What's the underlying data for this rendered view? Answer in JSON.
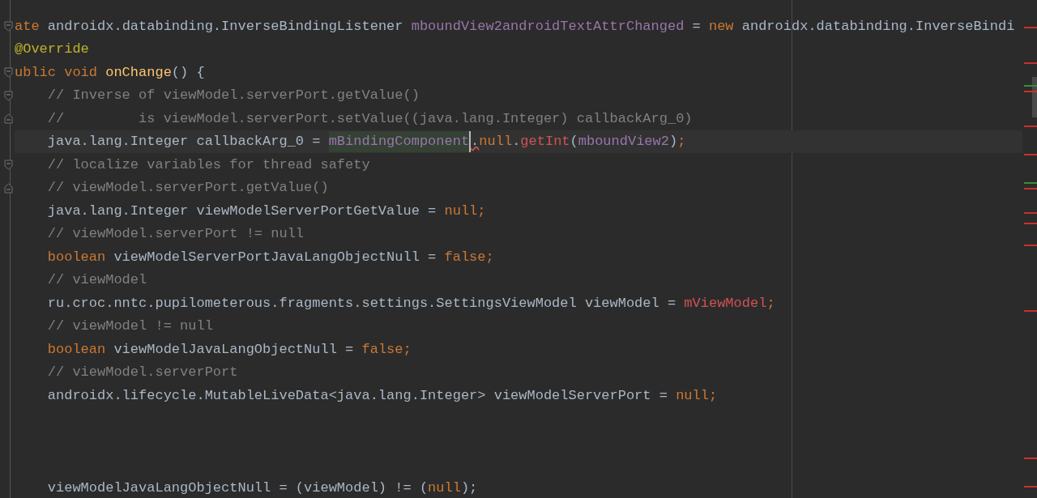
{
  "editor": {
    "lines": [
      {
        "current": false,
        "fold_start": true,
        "fold_end": false,
        "tokens": [
          {
            "kind": "keyword",
            "text": "ate"
          },
          {
            "kind": "plain",
            "text": " androidx.databinding.InverseBindingListener "
          },
          {
            "kind": "field",
            "text": "mboundView2androidTextAttrChanged"
          },
          {
            "kind": "plain",
            "text": " = "
          },
          {
            "kind": "keyword",
            "text": "new"
          },
          {
            "kind": "plain",
            "text": " androidx.databinding.InverseBindi"
          }
        ]
      },
      {
        "current": false,
        "fold_start": false,
        "fold_end": false,
        "tokens": [
          {
            "kind": "annotation",
            "text": "@Override"
          }
        ]
      },
      {
        "current": false,
        "fold_start": true,
        "fold_end": false,
        "tokens": [
          {
            "kind": "keyword",
            "text": "ublic void "
          },
          {
            "kind": "method",
            "text": "onChange"
          },
          {
            "kind": "plain",
            "text": "() {"
          }
        ]
      },
      {
        "current": false,
        "fold_start": true,
        "fold_end": false,
        "tokens": [
          {
            "kind": "comment",
            "text": "    // Inverse of viewModel.serverPort.getValue()"
          }
        ]
      },
      {
        "current": false,
        "fold_start": false,
        "fold_end": true,
        "tokens": [
          {
            "kind": "comment",
            "text": "    //         is viewModel.serverPort.setValue((java.lang.Integer) callbackArg_0)"
          }
        ]
      },
      {
        "current": true,
        "fold_start": false,
        "fold_end": false,
        "tokens": [
          {
            "kind": "plain",
            "text": "    java.lang.Integer callbackArg_0 = "
          },
          {
            "kind": "field_match",
            "text": "mBindingComponent"
          },
          {
            "kind": "caret_dot",
            "text": "."
          },
          {
            "kind": "keyword",
            "text": "null"
          },
          {
            "kind": "plain",
            "text": "."
          },
          {
            "kind": "error",
            "text": "getInt"
          },
          {
            "kind": "plain",
            "text": "("
          },
          {
            "kind": "field",
            "text": "mboundView2"
          },
          {
            "kind": "plain",
            "text": ")"
          },
          {
            "kind": "keyword",
            "text": ";"
          }
        ]
      },
      {
        "current": false,
        "fold_start": true,
        "fold_end": false,
        "tokens": [
          {
            "kind": "comment",
            "text": "    // localize variables for thread safety"
          }
        ]
      },
      {
        "current": false,
        "fold_start": false,
        "fold_end": true,
        "tokens": [
          {
            "kind": "comment",
            "text": "    // viewModel.serverPort.getValue()"
          }
        ]
      },
      {
        "current": false,
        "tokens": [
          {
            "kind": "plain",
            "text": "    java.lang.Integer viewModelServerPortGetValue = "
          },
          {
            "kind": "keyword",
            "text": "null;"
          }
        ]
      },
      {
        "current": false,
        "tokens": [
          {
            "kind": "comment",
            "text": "    // viewModel.serverPort != null"
          }
        ]
      },
      {
        "current": false,
        "tokens": [
          {
            "kind": "keyword",
            "text": "    boolean"
          },
          {
            "kind": "plain",
            "text": " viewModelServerPortJavaLangObjectNull = "
          },
          {
            "kind": "keyword",
            "text": "false;"
          }
        ]
      },
      {
        "current": false,
        "tokens": [
          {
            "kind": "comment",
            "text": "    // viewModel"
          }
        ]
      },
      {
        "current": false,
        "tokens": [
          {
            "kind": "plain",
            "text": "    ru.croc.nntc.pupilometerous.fragments.settings.SettingsViewModel viewModel = "
          },
          {
            "kind": "error",
            "text": "mViewModel"
          },
          {
            "kind": "keyword",
            "text": ";"
          }
        ]
      },
      {
        "current": false,
        "tokens": [
          {
            "kind": "comment",
            "text": "    // viewModel != null"
          }
        ]
      },
      {
        "current": false,
        "tokens": [
          {
            "kind": "keyword",
            "text": "    boolean"
          },
          {
            "kind": "plain",
            "text": " viewModelJavaLangObjectNull = "
          },
          {
            "kind": "keyword",
            "text": "false;"
          }
        ]
      },
      {
        "current": false,
        "tokens": [
          {
            "kind": "comment",
            "text": "    // viewModel.serverPort"
          }
        ]
      },
      {
        "current": false,
        "tokens": [
          {
            "kind": "plain",
            "text": "    androidx.lifecycle.MutableLiveData<java.lang.Integer> viewModelServerPort = "
          },
          {
            "kind": "keyword",
            "text": "null;"
          }
        ]
      },
      {
        "kind": "blank"
      },
      {
        "kind": "blank"
      },
      {
        "kind": "blank"
      },
      {
        "current": false,
        "tokens": [
          {
            "kind": "plain",
            "text": "    viewModelJavaLangObjectNull = (viewModel) != ("
          },
          {
            "kind": "keyword",
            "text": "null"
          },
          {
            "kind": "plain",
            "text": ");"
          }
        ]
      }
    ]
  }
}
